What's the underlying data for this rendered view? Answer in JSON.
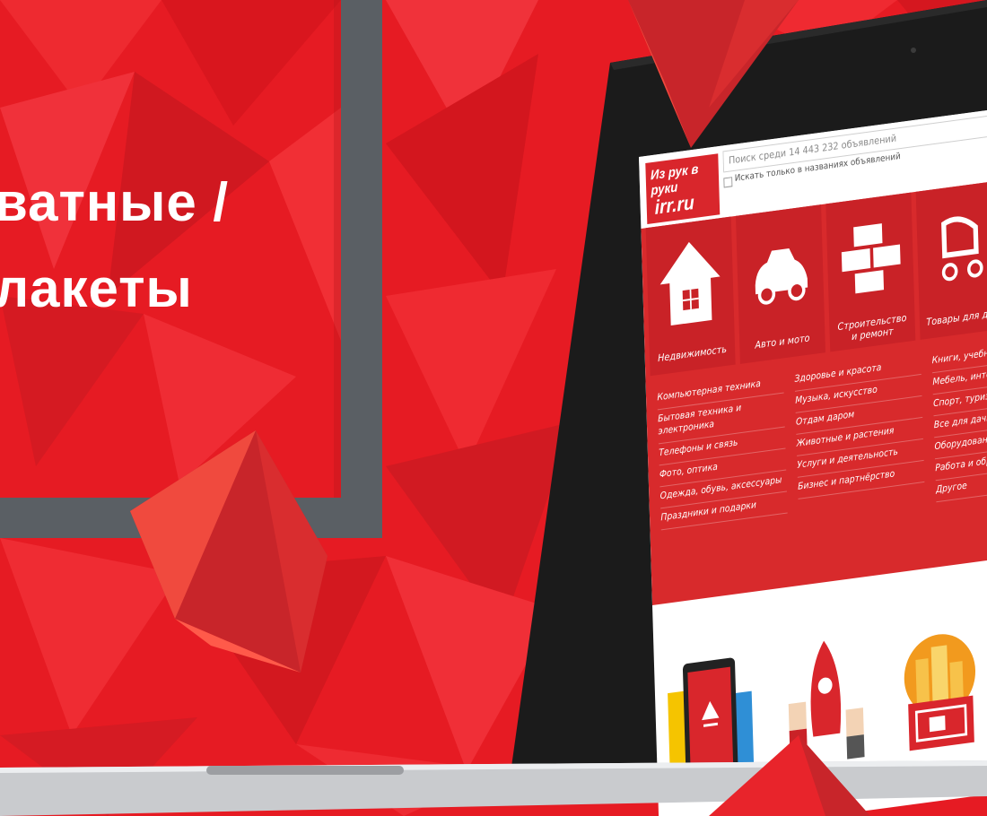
{
  "headline": {
    "line1": "ватные /",
    "line2": "лакеты"
  },
  "site": {
    "logo_top": "Из рук в руки",
    "logo_bottom": "irr.ru",
    "search_placeholder": "Поиск среди 14 443 232 объявлений",
    "checkbox_label": "Искать только в названиях объявлений"
  },
  "categories": [
    {
      "label": "Недвижимость",
      "icon": "house-icon"
    },
    {
      "label": "Авто и мото",
      "icon": "car-icon"
    },
    {
      "label": "Строительство\nи ремонт",
      "icon": "bricks-icon"
    },
    {
      "label": "Товары для дет",
      "icon": "stroller-icon"
    }
  ],
  "links": {
    "col1": [
      "Компьютерная техника",
      "Бытовая техника и электроника",
      "Телефоны и связь",
      "Фото, оптика",
      "Одежда, обувь, аксессуары",
      "Праздники и подарки"
    ],
    "col2": [
      "Здоровье и красота",
      "Музыка, искусство",
      "Отдам даром",
      "Животные и растения",
      "Услуги и деятельность",
      "Бизнес и партнёрство"
    ],
    "col3": [
      "Книги, учебники, журналы",
      "Мебель, интерьер, обиход",
      "Спорт, туризм, отдых",
      "Все для дачи",
      "Оборудование",
      "Работа и образование",
      "Другое"
    ]
  },
  "colors": {
    "brand_red": "#e61b23",
    "frame_gray": "#5a5f64",
    "panel_red": "#d82a2c"
  }
}
